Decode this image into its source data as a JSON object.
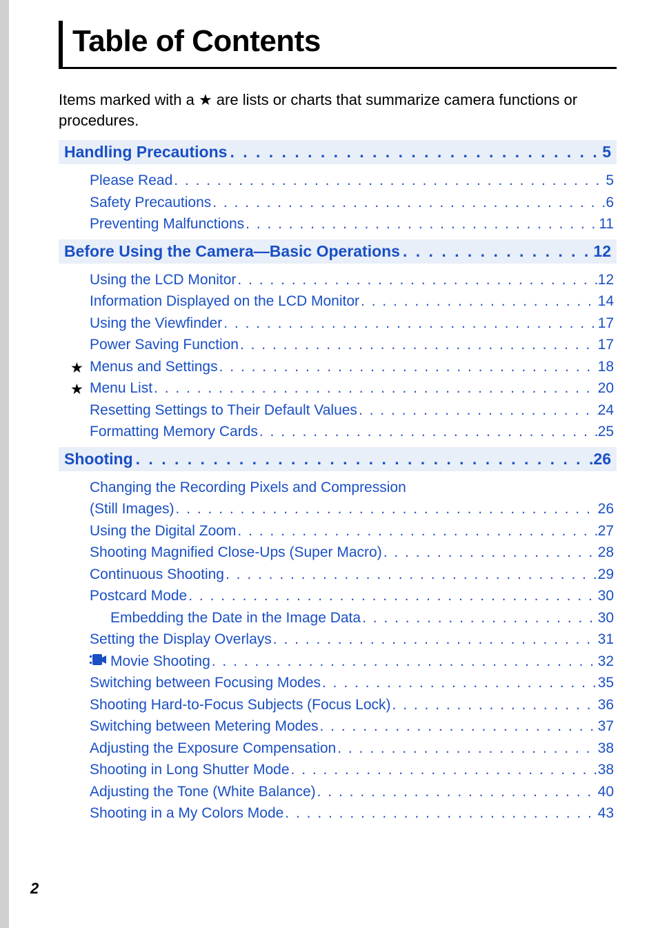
{
  "page_title": "Table of Contents",
  "intro": "Items marked with a ★ are lists or charts that summarize camera functions or procedures.",
  "dotsLong": ". . . . . . . . . . . . . . . . . . . . . . . . . . . . . . . . . . . . . . . . . . . . . . . . . . . . . . . . . . . . . . . . . . . . . . . . . . . . . . . . . . . . . . . . . . . . . . . . . . . . . . . . . . . . . .",
  "sections": [
    {
      "title": "Handling Precautions",
      "page": "5",
      "items": [
        {
          "label": "Please Read",
          "page": "5"
        },
        {
          "label": "Safety Precautions",
          "page": "6"
        },
        {
          "label": "Preventing Malfunctions",
          "page": "11"
        }
      ]
    },
    {
      "title": "Before Using the Camera—Basic Operations",
      "page": "12",
      "items": [
        {
          "label": "Using the LCD Monitor",
          "page": "12"
        },
        {
          "label": "Information Displayed on the LCD Monitor",
          "page": "14"
        },
        {
          "label": "Using the Viewfinder",
          "page": "17"
        },
        {
          "label": "Power Saving Function",
          "page": "17"
        },
        {
          "label": "Menus and Settings",
          "page": "18",
          "star": true
        },
        {
          "label": "Menu List",
          "page": "20",
          "star": true
        },
        {
          "label": "Resetting Settings to Their Default Values",
          "page": "24"
        },
        {
          "label": "Formatting Memory Cards",
          "page": "25"
        }
      ]
    },
    {
      "title": "Shooting",
      "page": "26",
      "items": [
        {
          "label": "Changing the Recording Pixels and Compression",
          "wrap": true
        },
        {
          "label": "(Still Images)",
          "page": "26"
        },
        {
          "label": "Using the Digital Zoom",
          "page": "27"
        },
        {
          "label": "Shooting Magnified Close-Ups (Super Macro)",
          "page": "28"
        },
        {
          "label": "Continuous Shooting",
          "page": "29"
        },
        {
          "label": "Postcard Mode",
          "page": "30"
        },
        {
          "label": "Embedding the Date in the Image Data",
          "page": "30",
          "indent": true
        },
        {
          "label": "Setting the Display Overlays",
          "page": "31"
        },
        {
          "label": "Movie Shooting",
          "page": "32",
          "movie": true
        },
        {
          "label": "Switching between Focusing Modes",
          "page": "35"
        },
        {
          "label": "Shooting Hard-to-Focus Subjects (Focus Lock)",
          "page": "36"
        },
        {
          "label": "Switching between Metering Modes",
          "page": "37"
        },
        {
          "label": "Adjusting the Exposure Compensation",
          "page": "38"
        },
        {
          "label": "Shooting in Long Shutter Mode",
          "page": "38"
        },
        {
          "label": "Adjusting the Tone (White Balance)",
          "page": "40"
        },
        {
          "label": "Shooting in a My Colors Mode",
          "page": "43"
        }
      ]
    }
  ],
  "page_number": "2"
}
